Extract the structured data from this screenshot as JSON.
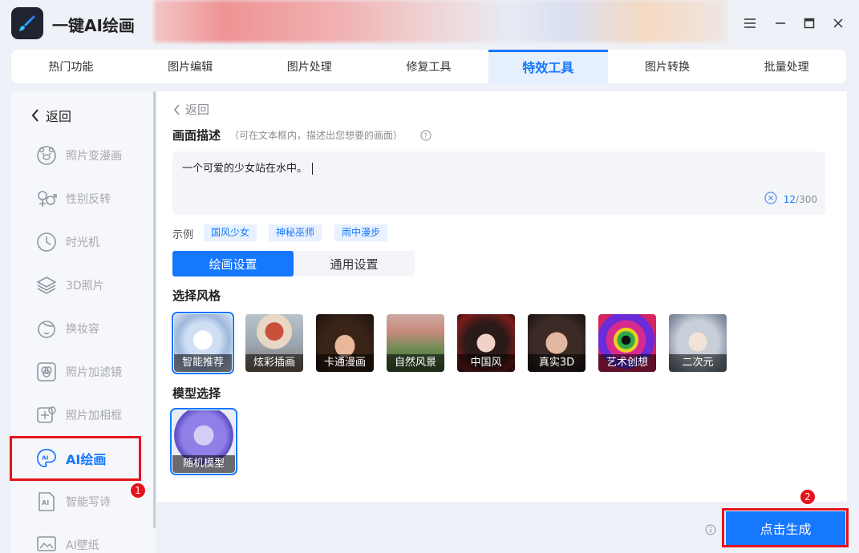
{
  "app": {
    "title": "一键AI绘画"
  },
  "tabs": [
    {
      "label": "热门功能"
    },
    {
      "label": "图片编辑"
    },
    {
      "label": "图片处理"
    },
    {
      "label": "修复工具"
    },
    {
      "label": "特效工具",
      "active": true
    },
    {
      "label": "图片转换"
    },
    {
      "label": "批量处理"
    }
  ],
  "sidebar": {
    "back": "返回",
    "items": [
      {
        "label": "照片变漫画",
        "icon": "bear-face-icon"
      },
      {
        "label": "性别反转",
        "icon": "gender-icon"
      },
      {
        "label": "时光机",
        "icon": "clock-icon"
      },
      {
        "label": "3D照片",
        "icon": "layers-icon"
      },
      {
        "label": "换妆容",
        "icon": "makeup-face-icon"
      },
      {
        "label": "照片加滤镜",
        "icon": "filter-icon"
      },
      {
        "label": "照片加相框",
        "icon": "frame-icon"
      },
      {
        "label": "AI绘画",
        "icon": "ai-paint-icon",
        "active": true
      },
      {
        "label": "智能写诗",
        "icon": "ai-doc-icon"
      },
      {
        "label": "AI壁纸",
        "icon": "wallpaper-icon"
      }
    ]
  },
  "main": {
    "back": "返回",
    "desc_title": "画面描述",
    "desc_hint": "（可在文本框内，描述出您想要的画面）",
    "prompt_text": "一个可爱的少女站在水中。",
    "count_current": "12",
    "count_max": "/300",
    "example_label": "示例",
    "examples": [
      "国风少女",
      "神秘巫师",
      "雨中漫步"
    ],
    "settings_tabs": [
      "绘画设置",
      "通用设置"
    ],
    "style_title": "选择风格",
    "styles": [
      {
        "label": "智能推荐"
      },
      {
        "label": "炫彩插画"
      },
      {
        "label": "卡通漫画"
      },
      {
        "label": "自然风景"
      },
      {
        "label": "中国风"
      },
      {
        "label": "真实3D"
      },
      {
        "label": "艺术创想"
      },
      {
        "label": "二次元"
      }
    ],
    "model_title": "模型选择",
    "model": {
      "label": "随机模型"
    }
  },
  "footer": {
    "generate_label": "点击生成"
  },
  "annotations": {
    "badge1": "1",
    "badge2": "2"
  },
  "colors": {
    "accent": "#1677ff",
    "highlight": "#e6121c"
  }
}
